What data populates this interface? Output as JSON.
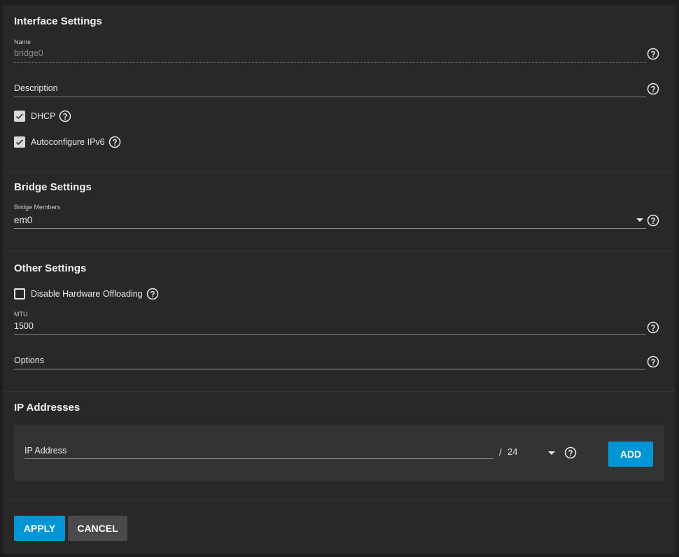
{
  "interface_settings": {
    "title": "Interface Settings",
    "name_label": "Name",
    "name_value": "bridge0",
    "description_placeholder": "Description",
    "dhcp_label": "DHCP",
    "dhcp_checked": true,
    "autoconf_label": "Autoconfigure IPv6",
    "autoconf_checked": true
  },
  "bridge_settings": {
    "title": "Bridge Settings",
    "members_label": "Bridge Members",
    "members_value": "em0"
  },
  "other_settings": {
    "title": "Other Settings",
    "disable_offload_label": "Disable Hardware Offloading",
    "disable_offload_checked": false,
    "mtu_label": "MTU",
    "mtu_value": "1500",
    "options_placeholder": "Options"
  },
  "ip_addresses": {
    "title": "IP Addresses",
    "ip_placeholder": "IP Address",
    "separator": "/",
    "netmask": "24",
    "add_label": "ADD"
  },
  "actions": {
    "apply_label": "APPLY",
    "cancel_label": "CANCEL"
  },
  "colors": {
    "primary": "#0095d5",
    "panel": "#282828",
    "background": "#1e1e1e",
    "secondary_button": "#4a4a4a"
  },
  "icons": [
    "help-icon",
    "checkmark-icon",
    "caret-down-icon"
  ]
}
